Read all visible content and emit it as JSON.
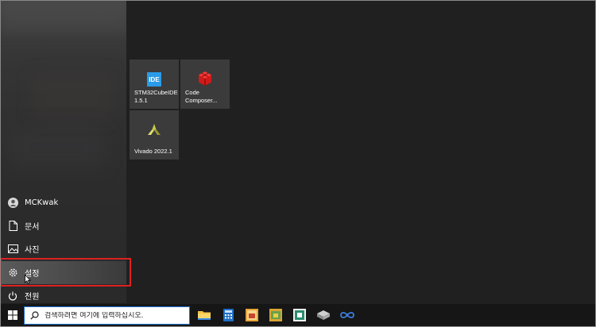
{
  "start_menu": {
    "nav_items": [
      {
        "id": "user",
        "label": "MCKwak",
        "icon": "user-icon"
      },
      {
        "id": "documents",
        "label": "문서",
        "icon": "document-icon"
      },
      {
        "id": "pictures",
        "label": "사진",
        "icon": "picture-icon"
      },
      {
        "id": "settings",
        "label": "설정",
        "icon": "gear-icon",
        "highlighted": true
      },
      {
        "id": "power",
        "label": "전원",
        "icon": "power-icon"
      }
    ],
    "tiles": [
      {
        "label": "STM32CubeIDE 1.5.1",
        "icon": "stm32cubeide-icon",
        "badge": "IDE"
      },
      {
        "label": "Code Composer...",
        "icon": "code-composer-icon"
      },
      {
        "label": "Vivado 2022.1",
        "icon": "vivado-icon"
      }
    ]
  },
  "taskbar": {
    "search_placeholder": "검색하려면 여기에 입력하십시오.",
    "pinned": [
      "file-explorer-icon",
      "calculator-icon",
      "app-icon-1",
      "app-icon-2",
      "app-icon-3",
      "app-icon-4",
      "app-icon-5"
    ]
  },
  "colors": {
    "highlight_box": "#e02020",
    "search_border": "#1e6fd0",
    "ide_blue": "#2b9be8",
    "code_composer_red": "#d11a1a",
    "vivado_yellow": "#c8c84a"
  }
}
